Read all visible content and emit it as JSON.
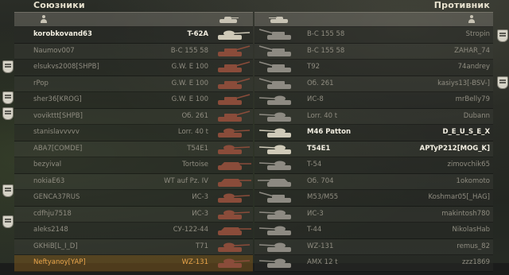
{
  "teams": {
    "allies_title": "Союзники",
    "enemies_title": "Противник"
  },
  "colors": {
    "alive_text": "#f3efe2",
    "dead_text": "#8f8c80",
    "self_text": "#e8a34a",
    "ally_tank_tint": "#8a4c3a",
    "enemy_tank_tint": "#8d8a82"
  },
  "allies": [
    {
      "player": "korobkovand63",
      "vehicle": "T-62A",
      "alive": true,
      "badge": false,
      "self": false,
      "icon": "tank-medium-icon"
    },
    {
      "player": "Naumov007",
      "vehicle": "B-C 155 58",
      "alive": false,
      "badge": false,
      "self": false,
      "icon": "artillery-icon"
    },
    {
      "player": "elsukvs2008[SHPB]",
      "vehicle": "G.W. E 100",
      "alive": false,
      "badge": true,
      "self": false,
      "icon": "artillery-icon"
    },
    {
      "player": "rPop",
      "vehicle": "G.W. E 100",
      "alive": false,
      "badge": false,
      "self": false,
      "icon": "artillery-icon"
    },
    {
      "player": "sher36[KROG]",
      "vehicle": "G.W. E 100",
      "alive": false,
      "badge": true,
      "self": false,
      "icon": "artillery-icon"
    },
    {
      "player": "vovikttt[SHPB]",
      "vehicle": "Об. 261",
      "alive": false,
      "badge": true,
      "self": false,
      "icon": "artillery-icon"
    },
    {
      "player": "stanislavvvvv",
      "vehicle": "Lorr. 40 t",
      "alive": false,
      "badge": false,
      "self": false,
      "icon": "tank-medium-icon"
    },
    {
      "player": "ABA7[COMDE]",
      "vehicle": "T54E1",
      "alive": false,
      "badge": false,
      "self": false,
      "icon": "tank-heavy-icon"
    },
    {
      "player": "bezyival",
      "vehicle": "Tortoise",
      "alive": false,
      "badge": false,
      "self": false,
      "icon": "tank-destroyer-icon"
    },
    {
      "player": "nokiaE63",
      "vehicle": "WT auf Pz. IV",
      "alive": false,
      "badge": false,
      "self": false,
      "icon": "tank-destroyer-icon"
    },
    {
      "player": "GENCA37RUS",
      "vehicle": "ИС-3",
      "alive": false,
      "badge": true,
      "self": false,
      "icon": "tank-heavy-icon"
    },
    {
      "player": "cdfhju7518",
      "vehicle": "ИС-3",
      "alive": false,
      "badge": false,
      "self": false,
      "icon": "tank-heavy-icon"
    },
    {
      "player": "aleks2148",
      "vehicle": "СУ-122-44",
      "alive": false,
      "badge": true,
      "self": false,
      "icon": "tank-destroyer-icon"
    },
    {
      "player": "GKHiB[L_I_D]",
      "vehicle": "T71",
      "alive": false,
      "badge": false,
      "self": false,
      "icon": "tank-light-icon"
    },
    {
      "player": "Neftyanoy[YAP]",
      "vehicle": "WZ-131",
      "alive": false,
      "badge": false,
      "self": true,
      "icon": "tank-light-icon"
    }
  ],
  "enemies": [
    {
      "player": "Stropin",
      "vehicle": "B-C 155 58",
      "alive": false,
      "badge": true,
      "icon": "artillery-icon"
    },
    {
      "player": "ZAHAR_74",
      "vehicle": "B-C 155 58",
      "alive": false,
      "badge": false,
      "icon": "artillery-icon"
    },
    {
      "player": "74andrey",
      "vehicle": "T92",
      "alive": false,
      "badge": false,
      "icon": "artillery-icon"
    },
    {
      "player": "kasiys13[-BSV-]",
      "vehicle": "Об. 261",
      "alive": false,
      "badge": true,
      "icon": "artillery-icon"
    },
    {
      "player": "mrBelly79",
      "vehicle": "ИС-8",
      "alive": false,
      "badge": false,
      "icon": "tank-heavy-icon"
    },
    {
      "player": "Dubann",
      "vehicle": "Lorr. 40 t",
      "alive": false,
      "badge": false,
      "icon": "tank-medium-icon"
    },
    {
      "player": "D_E_U_S_E_X",
      "vehicle": "M46 Patton",
      "alive": true,
      "badge": false,
      "icon": "tank-medium-icon"
    },
    {
      "player": "APTyP212[MOG_K]",
      "vehicle": "T54E1",
      "alive": true,
      "badge": false,
      "icon": "tank-heavy-icon"
    },
    {
      "player": "zimovchik65",
      "vehicle": "T-54",
      "alive": false,
      "badge": false,
      "icon": "tank-medium-icon"
    },
    {
      "player": "1okomoto",
      "vehicle": "Об. 704",
      "alive": false,
      "badge": false,
      "icon": "tank-destroyer-icon"
    },
    {
      "player": "Koshmar05[_HAG]",
      "vehicle": "M53/M55",
      "alive": false,
      "badge": false,
      "icon": "artillery-icon"
    },
    {
      "player": "makintosh780",
      "vehicle": "ИС-3",
      "alive": false,
      "badge": false,
      "icon": "tank-heavy-icon"
    },
    {
      "player": "NikolasHab",
      "vehicle": "T-44",
      "alive": false,
      "badge": false,
      "icon": "tank-medium-icon"
    },
    {
      "player": "remus_82",
      "vehicle": "WZ-131",
      "alive": false,
      "badge": false,
      "icon": "tank-light-icon"
    },
    {
      "player": "zzz1869",
      "vehicle": "AMX 12 t",
      "alive": false,
      "badge": false,
      "icon": "tank-light-icon"
    }
  ]
}
